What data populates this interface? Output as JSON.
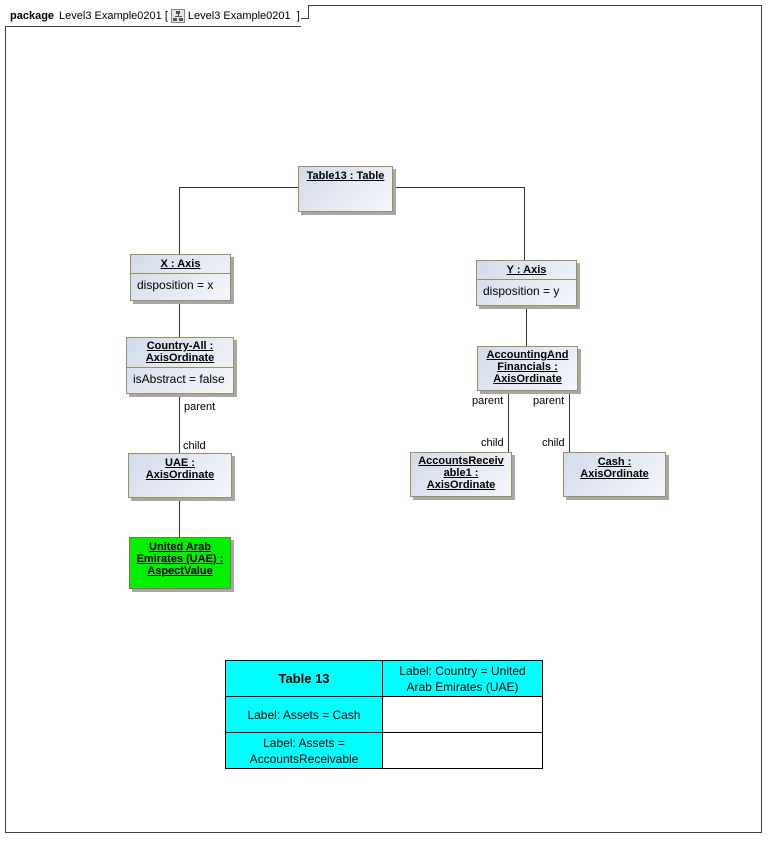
{
  "frame": {
    "keyword": "package",
    "name": "Level3 Example0201",
    "diagram_icon": "class-diagram-icon",
    "diagram_name": "Level3 Example0201"
  },
  "nodes": {
    "table13": {
      "title": "Table13 : Table"
    },
    "x_axis": {
      "title": "X : Axis",
      "attr": "disposition = x"
    },
    "y_axis": {
      "title": "Y : Axis",
      "attr": "disposition = y"
    },
    "country_all": {
      "title_l1": "Country-All :",
      "title_l2": "AxisOrdinate",
      "attr": "isAbstract = false"
    },
    "uae": {
      "title_l1": "UAE :",
      "title_l2": "AxisOrdinate"
    },
    "uae_aspect": {
      "title_l1": "United Arab",
      "title_l2": "Emirates (UAE) :",
      "title_l3": "AspectValue",
      "color": "#00f000"
    },
    "accounting": {
      "title_l1": "AccountingAnd",
      "title_l2": "Financials :",
      "title_l3": "AxisOrdinate"
    },
    "accounts_receivable": {
      "title_l1": "AccountsReceiv",
      "title_l2": "able1 :",
      "title_l3": "AxisOrdinate"
    },
    "cash": {
      "title_l1": "Cash :",
      "title_l2": "AxisOrdinate"
    }
  },
  "roles": {
    "parent": "parent",
    "child": "child"
  },
  "table": {
    "header": "Table 13",
    "column_header_l1": "Label: Country = United",
    "column_header_l2": "Arab Emirates (UAE)",
    "rows": [
      {
        "label_l1": "Label: Assets = Cash",
        "label_l2": "",
        "value": ""
      },
      {
        "label_l1": "Label: Assets =",
        "label_l2": "AccountsReceivable",
        "value": ""
      }
    ],
    "header_color": "#00ffff"
  }
}
